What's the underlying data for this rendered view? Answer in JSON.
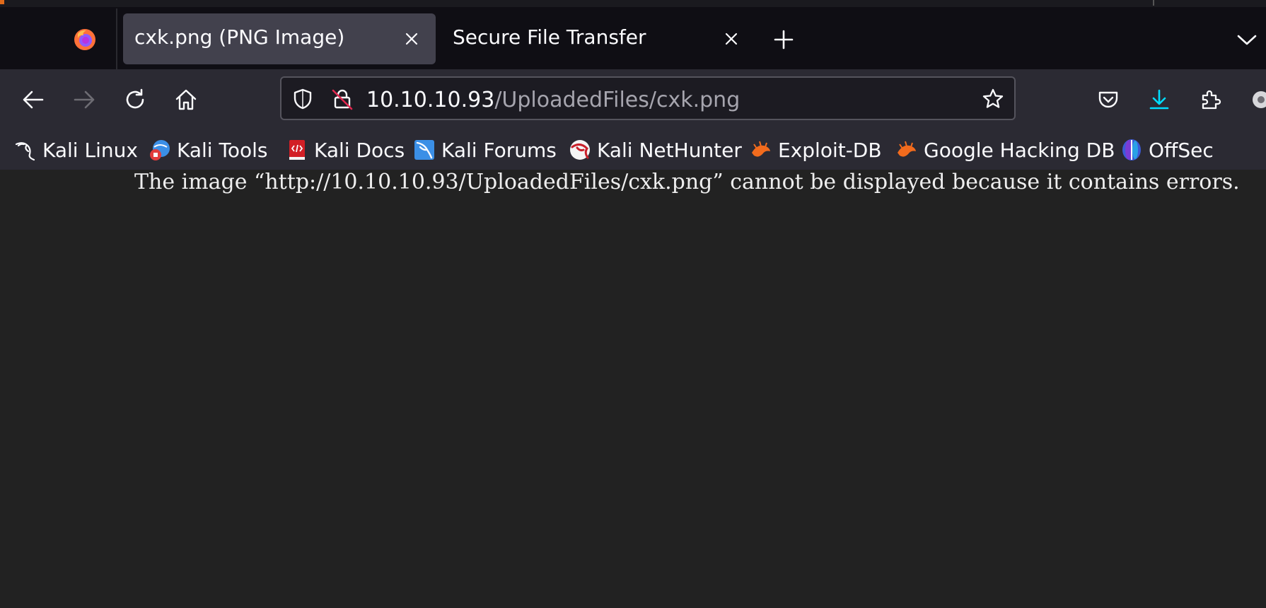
{
  "tabs": [
    {
      "title": "cxk.png (PNG Image)",
      "active": true
    },
    {
      "title": "Secure File Transfer",
      "active": false
    }
  ],
  "url": {
    "host": "10.10.10.93",
    "path": "/UploadedFiles/cxk.png"
  },
  "bookmarks": [
    {
      "label": "Kali Linux",
      "icon": "kali-dragon-icon"
    },
    {
      "label": "Kali Tools",
      "icon": "kali-tools-icon"
    },
    {
      "label": "Kali Docs",
      "icon": "kali-docs-icon"
    },
    {
      "label": "Kali Forums",
      "icon": "kali-forums-icon"
    },
    {
      "label": "Kali NetHunter",
      "icon": "kali-nethunter-icon"
    },
    {
      "label": "Exploit-DB",
      "icon": "exploit-db-icon"
    },
    {
      "label": "Google Hacking DB",
      "icon": "ghdb-icon"
    },
    {
      "label": "OffSec",
      "icon": "offsec-icon"
    }
  ],
  "content": {
    "message": "The image “http://10.10.10.93/UploadedFiles/cxk.png” cannot be displayed because it contains errors."
  },
  "colors": {
    "tab_bar": "#0f0e14",
    "toolbar": "#2b2a33",
    "active_tab": "#42414d",
    "page": "#222222",
    "accent": "#0df"
  }
}
